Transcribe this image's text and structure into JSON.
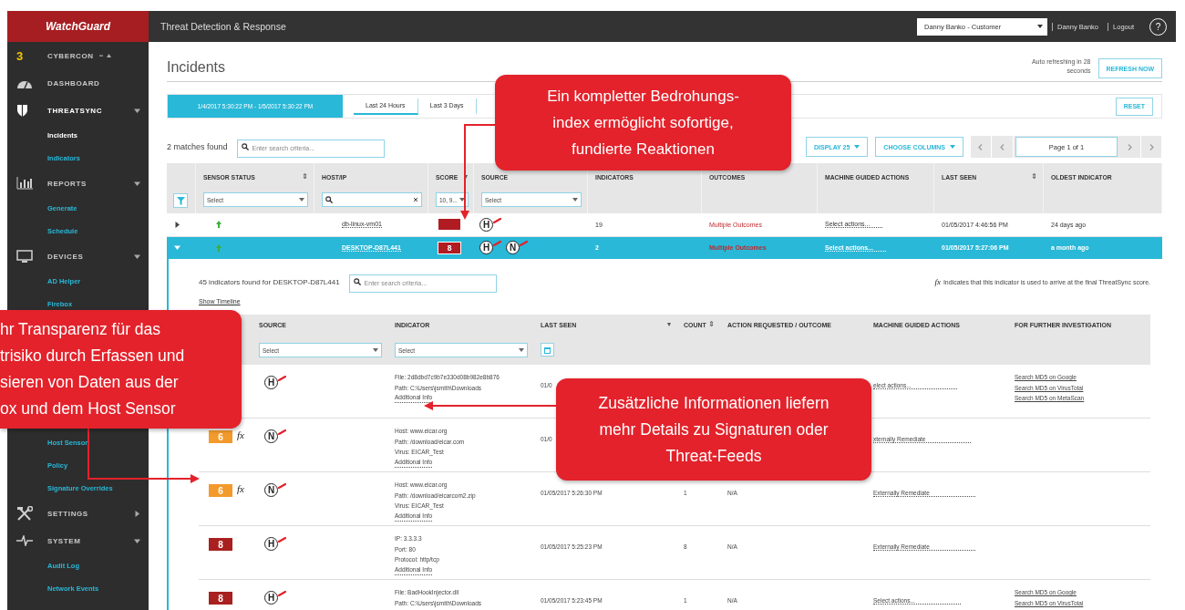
{
  "header": {
    "logo": "WatchGuard",
    "title": "Threat Detection & Response",
    "account": "Danny Banko - Customer",
    "user": "Danny Banko",
    "logout": "Logout",
    "help": "?"
  },
  "sidebar": {
    "account": {
      "number": "3",
      "name": "CYBERCON"
    },
    "sections": [
      {
        "label": "DASHBOARD",
        "kind": "dashboard"
      },
      {
        "label": "THREATSYNC",
        "kind": "shield",
        "expanded": true,
        "children": [
          {
            "label": "Incidents",
            "selected": true
          },
          {
            "label": "Indicators",
            "selected": false
          }
        ]
      },
      {
        "label": "REPORTS",
        "kind": "chart",
        "expanded": true,
        "children": [
          {
            "label": "Generate",
            "selected": false
          },
          {
            "label": "Schedule",
            "selected": false
          }
        ]
      },
      {
        "label": "DEVICES",
        "kind": "monitor",
        "expanded": true,
        "children": [
          {
            "label": "AD Helper",
            "selected": false
          },
          {
            "label": "Firebox",
            "selected": false
          },
          {
            "label": "Host Sensor",
            "selected": false
          },
          {
            "label": "Policy",
            "selected": false
          },
          {
            "label": "Signature Overrides",
            "selected": false
          }
        ]
      },
      {
        "label": "SETTINGS",
        "kind": "tools",
        "expanded": false
      },
      {
        "label": "SYSTEM",
        "kind": "pulse",
        "expanded": true,
        "children": [
          {
            "label": "Audit Log",
            "selected": false
          },
          {
            "label": "Network Events",
            "selected": false
          }
        ]
      }
    ]
  },
  "page": {
    "title": "Incidents",
    "refresh_note": "Auto refreshing in 28 seconds",
    "refresh_button": "REFRESH NOW"
  },
  "range_bar": {
    "custom_range": "1/4/2017 5:30:22 PM - 1/5/2017 5:30:22 PM",
    "tabs": [
      {
        "label": "Last 24 Hours",
        "selected": true
      },
      {
        "label": "Last 3 Days",
        "selected": false
      }
    ],
    "reset": "RESET"
  },
  "toolbar": {
    "matches": "2 matches found",
    "search_placeholder": "Enter search criteria...",
    "display": "DISPLAY 25",
    "columns": "CHOOSE COLUMNS",
    "page": "Page 1 of 1"
  },
  "incidents": {
    "columns": [
      {
        "label": "SENSOR STATUS",
        "sort": "⇕"
      },
      {
        "label": "HOST/IP"
      },
      {
        "label": "SCORE",
        "sort": "▾"
      },
      {
        "label": "SOURCE"
      },
      {
        "label": "INDICATORS"
      },
      {
        "label": "OUTCOMES"
      },
      {
        "label": "MACHINE GUIDED ACTIONS"
      },
      {
        "label": "LAST SEEN",
        "sort": "⇕"
      },
      {
        "label": "OLDEST INDICATOR"
      }
    ],
    "filters": {
      "sensor_status": "Select",
      "score": "10, 9...",
      "source": "Select"
    },
    "rows": [
      {
        "selected": false,
        "expanded": false,
        "host": "db-linux-vm01",
        "color": "#b01c22",
        "sources": [
          "H"
        ],
        "indicators": "19",
        "outcomes": "Multiple Outcomes",
        "actions": "Select actions...",
        "last_seen": "01/05/2017 4:46:56 PM",
        "oldest": "24 days ago"
      },
      {
        "selected": true,
        "expanded": true,
        "host": "DESKTOP-D87L441",
        "score": "8",
        "color": "#b01c22",
        "sources": [
          "H",
          "N"
        ],
        "indicators": "2",
        "outcomes": "Multiple Outcomes",
        "actions": "Select actions...",
        "last_seen": "01/05/2017 5:27:06 PM",
        "oldest": "a month ago"
      }
    ]
  },
  "detail": {
    "summary": "45 indicators found for DESKTOP-D87L441",
    "search_placeholder": "Enter search criteria...",
    "legend_symbol": "fx",
    "legend": "Indicates that this indicator is used to arrive at the final ThreatSync score.",
    "timeline_link": "Show Timeline",
    "columns": [
      {
        "label": "SOURCE"
      },
      {
        "label": "INDICATOR"
      },
      {
        "label": "LAST SEEN",
        "sort": "▾"
      },
      {
        "label": "COUNT",
        "sort": "⇕"
      },
      {
        "label": "ACTION REQUESTED / OUTCOME"
      },
      {
        "label": "MACHINE GUIDED ACTIONS"
      },
      {
        "label": "FOR FURTHER INVESTIGATION"
      }
    ],
    "filters": {
      "source": "Select",
      "indicator": "Select"
    },
    "rows": [
      {
        "sources": [
          "H"
        ],
        "indicator": [
          "File: 2d8dbd7c9b7e330d08b982e8b876",
          "Path: C:\\Users\\jsmith\\Downloads"
        ],
        "info_link": "Additional Info",
        "last_seen": "01/0",
        "machine": "elect actions...",
        "links": [
          "Search MD5 on Google",
          "Search MD5 on VirusTotal",
          "Search MD5 on MetaScan"
        ]
      },
      {
        "score": "6",
        "color": "#f39a2c",
        "formula_mark": "fx",
        "sources": [
          "N"
        ],
        "indicator": [
          "Host: www.eicar.org",
          "Path: /download/eicar.com",
          "Virus: EICAR_Test"
        ],
        "info_link": "Additional Info",
        "last_seen": "01/0",
        "machine": "xternally Remediate"
      },
      {
        "score": "6",
        "color": "#f39a2c",
        "formula_mark": "fx",
        "sources": [
          "N"
        ],
        "indicator": [
          "Host: www.eicar.org",
          "Path: /download/eicarcom2.zip",
          "Virus: EICAR_Test"
        ],
        "info_link": "Additional Info",
        "last_seen": "01/05/2017 5:26:30 PM",
        "count": "1",
        "action": "N/A",
        "machine": "Externally Remediate"
      },
      {
        "score": "8",
        "color": "#a8201f",
        "sources": [
          "H"
        ],
        "indicator": [
          "IP: 3.3.3.3",
          "Port: 80",
          "Protocol: http/tcp"
        ],
        "info_link": "Additional Info",
        "last_seen": "01/05/2017 5:25:23 PM",
        "count": "8",
        "action": "N/A",
        "machine": "Externally Remediate"
      },
      {
        "score": "8",
        "color": "#a8201f",
        "sources": [
          "H"
        ],
        "indicator": [
          "File: BadHookInjector.dll",
          "Path: C:\\Users\\jsmith\\Downloads"
        ],
        "last_seen": "01/05/2017 5:23:45 PM",
        "count": "1",
        "action": "N/A",
        "machine": "Select actions...",
        "links": [
          "Search MD5 on Google",
          "Search MD5 on VirusTotal"
        ]
      }
    ]
  },
  "callouts": [
    {
      "lines": [
        "Ein kompletter Bedrohungs-",
        "index ermöglicht sofortige,",
        "fundierte Reaktionen"
      ]
    },
    {
      "lines": [
        "hr Transparenz für das",
        "trisiko durch Erfassen und",
        "sieren von Daten aus der",
        "ox und dem Host Sensor"
      ]
    },
    {
      "lines": [
        "Zusätzliche Informationen liefern",
        "mehr Details zu Signaturen oder",
        "Threat-Feeds"
      ]
    }
  ]
}
